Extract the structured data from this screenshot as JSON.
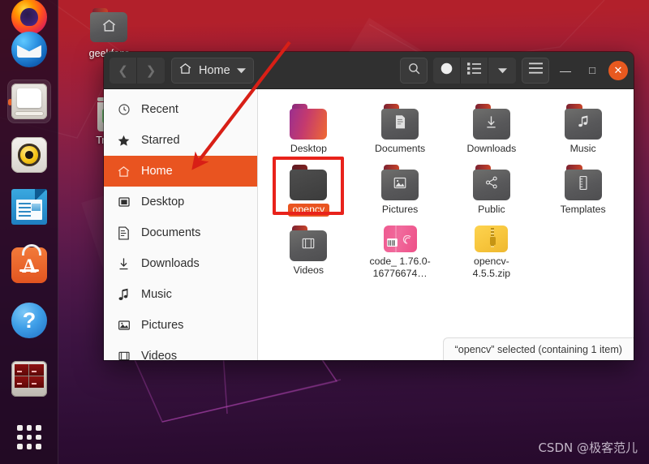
{
  "desktop": {
    "icons": [
      {
        "name": "geekfanr",
        "type": "home-folder"
      },
      {
        "name": "Trash",
        "type": "trash"
      }
    ],
    "watermark": "CSDN @极客范儿",
    "wallpaper_top_color": "#b2202b",
    "wallpaper_bottom_color": "#270a2c"
  },
  "dock": {
    "items": [
      {
        "label": "Firefox",
        "icon": "firefox-icon",
        "active": false
      },
      {
        "label": "Thunderbird Mail",
        "icon": "thunderbird-icon",
        "active": false
      },
      {
        "label": "Files",
        "icon": "files-icon",
        "active": true
      },
      {
        "label": "Rhythmbox",
        "icon": "rhythmbox-icon",
        "active": false
      },
      {
        "label": "LibreOffice Writer",
        "icon": "libreoffice-writer-icon",
        "active": false
      },
      {
        "label": "Ubuntu Software",
        "icon": "ubuntu-software-icon",
        "active": false
      },
      {
        "label": "Help",
        "icon": "help-icon",
        "active": false
      },
      {
        "label": "Terminal",
        "icon": "terminal-icon",
        "active": false
      },
      {
        "label": "Show Applications",
        "icon": "apps-grid-icon",
        "active": false
      }
    ]
  },
  "window": {
    "header": {
      "back_label": "❮",
      "forward_label": "❯",
      "path_label": "Home",
      "path_icon": "home-icon",
      "dropdown_icon": "chevron-down-icon",
      "search_icon": "search-icon",
      "grid_view_icon": "grid-view-icon",
      "list_view_icon": "list-view-icon",
      "view_dropdown_icon": "chevron-down-icon",
      "menu_icon": "hamburger-menu-icon",
      "minimize_label": "—",
      "maximize_label": "□",
      "close_label": "✕"
    },
    "sidebar": {
      "items": [
        {
          "label": "Recent",
          "icon": "clock-icon",
          "selected": false
        },
        {
          "label": "Starred",
          "icon": "star-icon",
          "selected": false
        },
        {
          "label": "Home",
          "icon": "home-icon",
          "selected": true
        },
        {
          "label": "Desktop",
          "icon": "desktop-icon",
          "selected": false
        },
        {
          "label": "Documents",
          "icon": "document-icon",
          "selected": false
        },
        {
          "label": "Downloads",
          "icon": "download-icon",
          "selected": false
        },
        {
          "label": "Music",
          "icon": "music-icon",
          "selected": false
        },
        {
          "label": "Pictures",
          "icon": "image-icon",
          "selected": false
        },
        {
          "label": "Videos",
          "icon": "video-icon",
          "selected": false
        }
      ]
    },
    "files": [
      {
        "label": "Desktop",
        "kind": "folder-desktop",
        "selected": false,
        "overlay": "none"
      },
      {
        "label": "Documents",
        "kind": "folder-gray",
        "selected": false,
        "overlay": "document-icon"
      },
      {
        "label": "Downloads",
        "kind": "folder-gray",
        "selected": false,
        "overlay": "download-icon"
      },
      {
        "label": "Music",
        "kind": "folder-gray",
        "selected": false,
        "overlay": "music-icon"
      },
      {
        "label": "opencv",
        "kind": "folder-dark",
        "selected": true,
        "overlay": "none"
      },
      {
        "label": "Pictures",
        "kind": "folder-gray",
        "selected": false,
        "overlay": "image-icon"
      },
      {
        "label": "Public",
        "kind": "folder-gray",
        "selected": false,
        "overlay": "share-icon"
      },
      {
        "label": "Templates",
        "kind": "folder-gray",
        "selected": false,
        "overlay": "ruler-icon"
      },
      {
        "label": "Videos",
        "kind": "folder-gray",
        "selected": false,
        "overlay": "film-icon"
      },
      {
        "label": "code_ 1.76.0-16776674…",
        "kind": "deb-package",
        "selected": false,
        "overlay": "debian-icon"
      },
      {
        "label": "opencv-4.5.5.zip",
        "kind": "zip-archive",
        "selected": false,
        "overlay": "zipper-icon"
      }
    ],
    "statusbar": {
      "text": "“opencv” selected  (containing 1 item)"
    }
  },
  "annotation": {
    "box_target": "opencv",
    "arrow_target": "Home",
    "color": "#e8221b"
  },
  "colors": {
    "accent_orange": "#e95420",
    "header_dark": "#303030",
    "sidebar_bg": "#fafafa",
    "close_button": "#e8591f",
    "annotation_red": "#e8221b"
  }
}
